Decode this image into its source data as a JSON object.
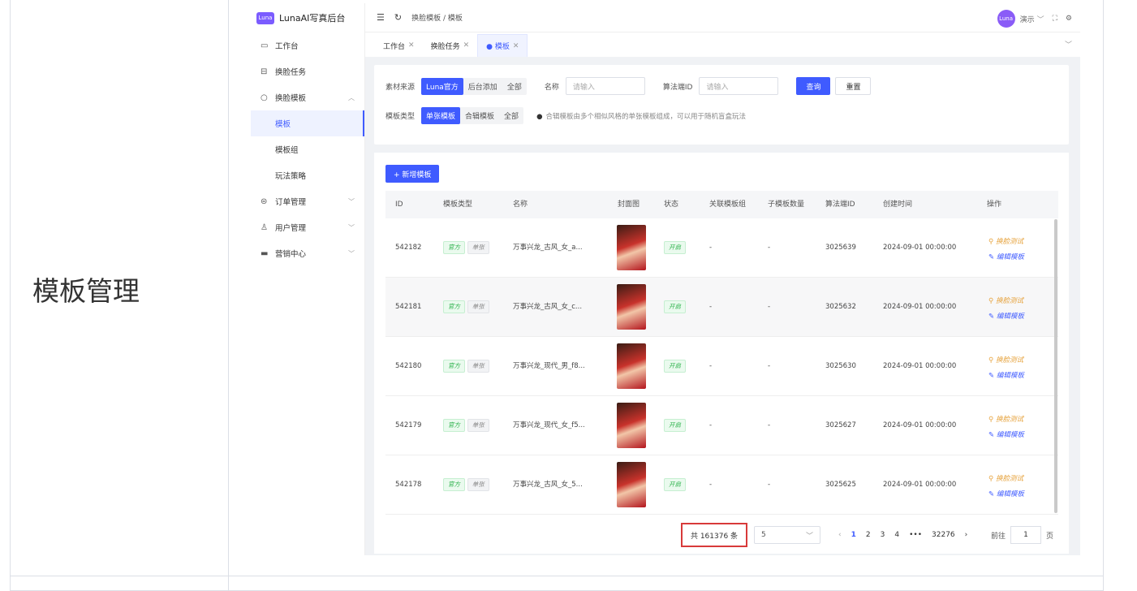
{
  "doc": {
    "section_label": "模板管理"
  },
  "app": {
    "logo_badge": "Luna",
    "title": "LunaAI写真后台"
  },
  "sidebar": {
    "items": [
      {
        "label": "工作台",
        "icon": "monitor-icon"
      },
      {
        "label": "换脸任务",
        "icon": "task-icon"
      },
      {
        "label": "换脸模板",
        "icon": "template-icon",
        "expanded": true
      }
    ],
    "subitems": [
      {
        "label": "模板",
        "active": true
      },
      {
        "label": "模板组"
      },
      {
        "label": "玩法策略"
      }
    ],
    "items2": [
      {
        "label": "订单管理",
        "icon": "order-icon"
      },
      {
        "label": "用户管理",
        "icon": "user-icon"
      },
      {
        "label": "营销中心",
        "icon": "marketing-icon"
      }
    ]
  },
  "topbar": {
    "breadcrumb": "换脸模板 / 模板",
    "user_name": "演示",
    "avatar_text": "Luna"
  },
  "tabs": [
    {
      "label": "工作台"
    },
    {
      "label": "换脸任务"
    },
    {
      "label": "● 模板",
      "active": true
    }
  ],
  "filters": {
    "source_label": "素材来源",
    "source_options": [
      "Luna官方",
      "后台添加",
      "全部"
    ],
    "name_label": "名称",
    "name_placeholder": "请输入",
    "algo_label": "算法端ID",
    "algo_placeholder": "请输入",
    "query_btn": "查询",
    "reset_btn": "重置",
    "type_label": "模板类型",
    "type_options": [
      "单张模板",
      "合辑模板",
      "全部"
    ],
    "hint": "合辑模板由多个相似风格的单张模板组成，可以用于随机盲盒玩法"
  },
  "table": {
    "add_btn": "+ 新增模板",
    "headers": [
      "ID",
      "模板类型",
      "名称",
      "封面图",
      "状态",
      "关联模板组",
      "子模板数量",
      "算法端ID",
      "创建时间",
      "操作"
    ],
    "rows": [
      {
        "id": "542182",
        "source": "官方",
        "kind": "单张",
        "name": "万事兴龙_古风_女_a...",
        "status": "开启",
        "group": "-",
        "subcount": "-",
        "algo": "3025639",
        "created": "2024-09-01 00:00:00",
        "op1": "换脸测试",
        "op2": "编辑模板"
      },
      {
        "id": "542181",
        "source": "官方",
        "kind": "单张",
        "name": "万事兴龙_古风_女_c...",
        "status": "开启",
        "group": "-",
        "subcount": "-",
        "algo": "3025632",
        "created": "2024-09-01 00:00:00",
        "op1": "换脸测试",
        "op2": "编辑模板"
      },
      {
        "id": "542180",
        "source": "官方",
        "kind": "单张",
        "name": "万事兴龙_现代_男_f8...",
        "status": "开启",
        "group": "-",
        "subcount": "-",
        "algo": "3025630",
        "created": "2024-09-01 00:00:00",
        "op1": "换脸测试",
        "op2": "编辑模板"
      },
      {
        "id": "542179",
        "source": "官方",
        "kind": "单张",
        "name": "万事兴龙_现代_女_f5...",
        "status": "开启",
        "group": "-",
        "subcount": "-",
        "algo": "3025627",
        "created": "2024-09-01 00:00:00",
        "op1": "换脸测试",
        "op2": "编辑模板"
      },
      {
        "id": "542178",
        "source": "官方",
        "kind": "单张",
        "name": "万事兴龙_古风_女_5...",
        "status": "开启",
        "group": "-",
        "subcount": "-",
        "algo": "3025625",
        "created": "2024-09-01 00:00:00",
        "op1": "换脸测试",
        "op2": "编辑模板"
      }
    ]
  },
  "pager": {
    "total": "共 161376 条",
    "page_size": "5",
    "pages": [
      "1",
      "2",
      "3",
      "4",
      "•••",
      "32276"
    ],
    "current": "1",
    "goto_label": "前往",
    "goto_value": "1",
    "goto_suffix": "页"
  },
  "colors": {
    "accent": "#3f5bff",
    "highlight_border": "#d83a3a",
    "status_green": "#2fb34d",
    "test_orange": "#e6a23c"
  }
}
